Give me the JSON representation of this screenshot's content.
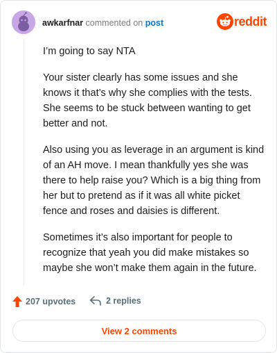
{
  "header": {
    "username": "awkarfnar",
    "action_text": "commented on",
    "post_link": "post",
    "brand_text": "reddit",
    "brand_icon": "reddit-logo-icon",
    "avatar_icon": "snoo-avatar-icon"
  },
  "comment": {
    "paragraphs": [
      "I’m going to say NTA",
      "Your sister clearly has some issues and she knows it that’s why she complies with the tests. She seems to be stuck between wanting to get better and not.",
      "Also using you as leverage in an argument is kind of an AH move. I mean thankfully yes she was there to help raise you? Which is a big thing from her but to pretend as if it was all white picket fence and roses and daisies is different.",
      "Sometimes it’s also important for people to recognize that yeah you did make mistakes so maybe she won’t make them again in the future."
    ]
  },
  "actions": {
    "upvotes_label": "207 upvotes",
    "replies_label": "2 replies",
    "upvote_icon": "upvote-arrow-icon",
    "reply_icon": "reply-arrow-icon"
  },
  "footer": {
    "view_comments_label": "View 2 comments"
  },
  "colors": {
    "brand": "#ff4500",
    "link": "#0079d3",
    "avatar_bg": "#c7a7e6",
    "muted": "#576f76"
  }
}
